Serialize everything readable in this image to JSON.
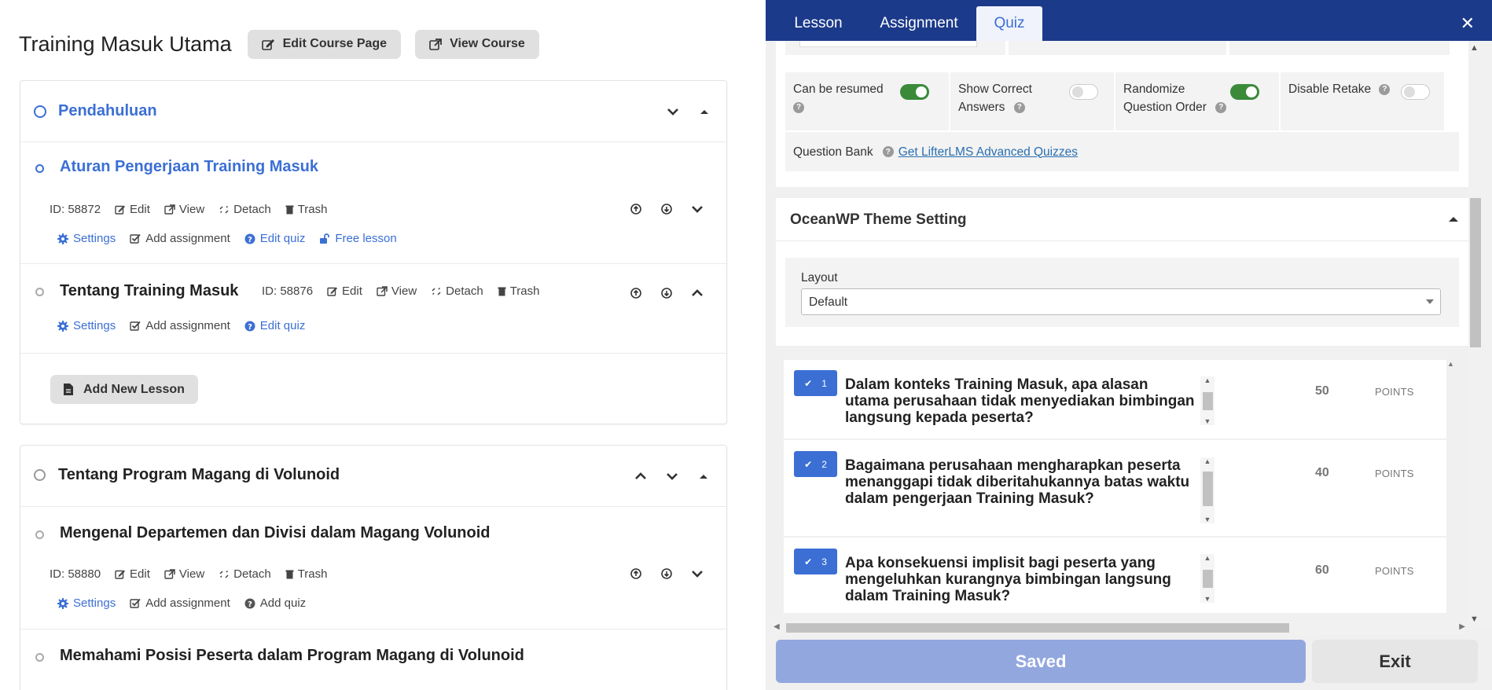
{
  "course": {
    "title": "Training Masuk Utama",
    "edit_label": "Edit Course Page",
    "view_label": "View Course"
  },
  "sections": [
    {
      "title": "Pendahuluan",
      "lessons": [
        {
          "title": "Aturan Pengerjaan Training Masuk",
          "id": "ID: 58872",
          "actions": [
            "Edit",
            "View",
            "Detach",
            "Trash"
          ],
          "links": [
            "Settings",
            "Add assignment",
            "Edit quiz",
            "Free lesson"
          ]
        },
        {
          "title": "Tentang Training Masuk",
          "id": "ID: 58876",
          "actions": [
            "Edit",
            "View",
            "Detach",
            "Trash"
          ],
          "links": [
            "Settings",
            "Add assignment",
            "Edit quiz"
          ]
        }
      ],
      "add_lesson": "Add New Lesson"
    },
    {
      "title": "Tentang Program Magang di Volunoid",
      "lessons": [
        {
          "title": "Mengenal Departemen dan Divisi dalam Magang Volunoid",
          "id": "ID: 58880",
          "actions": [
            "Edit",
            "View",
            "Detach",
            "Trash"
          ],
          "links": [
            "Settings",
            "Add assignment",
            "Add quiz"
          ]
        },
        {
          "title": "Memahami Posisi Peserta dalam Program Magang di Volunoid"
        }
      ]
    }
  ],
  "panel": {
    "tabs": [
      "Lesson",
      "Assignment",
      "Quiz"
    ],
    "active_tab": "Quiz",
    "settings": {
      "can_be_resumed": {
        "label": "Can be resumed",
        "on": true
      },
      "show_correct": {
        "label": "Show Correct Answers",
        "line1": "Show Correct",
        "line2": "Answers",
        "on": false
      },
      "randomize": {
        "label": "Randomize Question Order",
        "line1": "Randomize",
        "line2": "Question Order",
        "on": true
      },
      "disable_retake": {
        "label": "Disable Retake",
        "on": false
      },
      "question_bank_label": "Question Bank",
      "question_bank_link": "Get LifterLMS Advanced Quizzes"
    },
    "oceanwp": {
      "title": "OceanWP Theme Setting",
      "layout_label": "Layout",
      "layout_value": "Default"
    },
    "questions": [
      {
        "num": "1",
        "text": "Dalam konteks Training Masuk, apa alasan utama perusahaan tidak menyediakan bimbingan langsung kepada peserta?",
        "points": "50",
        "points_label": "POINTS"
      },
      {
        "num": "2",
        "text": "Bagaimana perusahaan mengharapkan peserta menanggapi tidak diberitahukannya batas waktu dalam pengerjaan Training Masuk?",
        "points": "40",
        "points_label": "POINTS"
      },
      {
        "num": "3",
        "text": "Apa konsekuensi implisit bagi peserta yang mengeluhkan kurangnya bimbingan langsung dalam Training Masuk?",
        "points": "60",
        "points_label": "POINTS"
      }
    ],
    "saved_label": "Saved",
    "exit_label": "Exit"
  },
  "colors": {
    "accent": "#3b6fd4",
    "header": "#1c3a8a",
    "toggle_on": "#3a8a3a",
    "saved_button": "#93a7df"
  }
}
